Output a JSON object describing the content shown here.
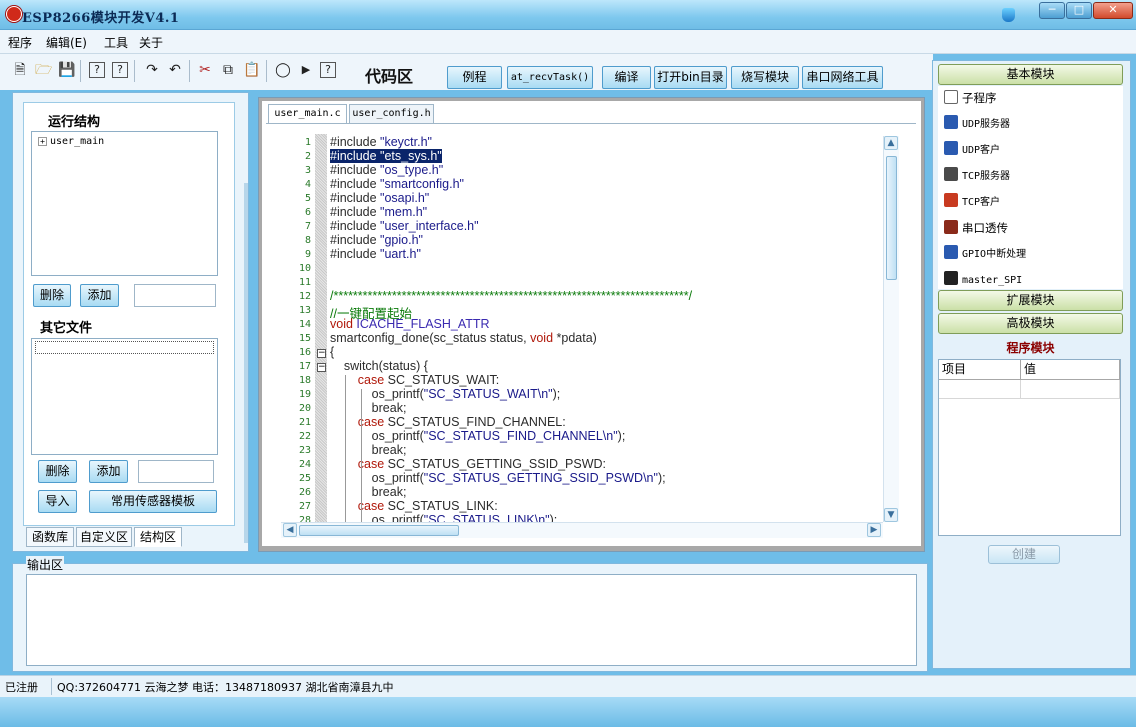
{
  "window": {
    "title": "ESP8266模块开发V4.1"
  },
  "menu": [
    "程序",
    "编辑(E)",
    "工具",
    "关于"
  ],
  "toolbar": {
    "code_area_label": "代码区",
    "buttons": [
      "例程",
      "at_recvTask()",
      "编译",
      "打开bin目录",
      "烧写模块",
      "串口网络工具"
    ]
  },
  "left_panel": {
    "run_structure_title": "运行结构",
    "tree_items": [
      "user_main"
    ],
    "delete_label": "删除",
    "add_label": "添加",
    "other_files_title": "其它文件",
    "import_label": "导入",
    "sensor_template_label": "常用传感器模板",
    "tabs": [
      "函数库",
      "自定义区",
      "结构区"
    ]
  },
  "editor": {
    "tabs": [
      "user_main.c",
      "user_config.h"
    ],
    "lines": [
      "#include \"keyctr.h\"",
      "#include \"ets_sys.h\"",
      "#include \"os_type.h\"",
      "#include \"smartconfig.h\"",
      "#include \"osapi.h\"",
      "#include \"mem.h\"",
      "#include \"user_interface.h\"",
      "#include \"gpio.h\"",
      "#include \"uart.h\"",
      "",
      "",
      "/*************************************************************************/",
      "//一键配置起始",
      "void ICACHE_FLASH_ATTR",
      "smartconfig_done(sc_status status, void *pdata)",
      "{",
      "    switch(status) {",
      "        case SC_STATUS_WAIT:",
      "            os_printf(\"SC_STATUS_WAIT\\n\");",
      "            break;",
      "        case SC_STATUS_FIND_CHANNEL:",
      "            os_printf(\"SC_STATUS_FIND_CHANNEL\\n\");",
      "            break;",
      "        case SC_STATUS_GETTING_SSID_PSWD:",
      "            os_printf(\"SC_STATUS_GETTING_SSID_PSWD\\n\");",
      "            break;",
      "        case SC_STATUS_LINK:",
      "            os_printf(\"SC_STATUS_LINK\\n\");"
    ],
    "highlighted_line": 2
  },
  "output": {
    "label": "输出区"
  },
  "right_panel": {
    "basic_modules": "基本模块",
    "module_items": [
      {
        "label": "子程序",
        "icon": "document-icon",
        "color": "#ffffff"
      },
      {
        "label": "UDP服务器",
        "icon": "network-icon",
        "color": "#2a5ab0"
      },
      {
        "label": "UDP客户",
        "icon": "network-icon",
        "color": "#2a5ab0"
      },
      {
        "label": "TCP服务器",
        "icon": "server-icon",
        "color": "#4a4a4a"
      },
      {
        "label": "TCP客户",
        "icon": "users-icon",
        "color": "#c83a20"
      },
      {
        "label": "串口透传",
        "icon": "plug-icon",
        "color": "#8a2a1a"
      },
      {
        "label": "GPIO中断处理",
        "icon": "gpio-icon",
        "color": "#2a5ab0"
      },
      {
        "label": "master_SPI",
        "icon": "chip-icon",
        "color": "#222222"
      }
    ],
    "extended_modules": "扩展模块",
    "advanced_modules": "高极模块",
    "program_module_title": "程序模块",
    "grid_headers": [
      "项目",
      "值"
    ],
    "create_label": "创建"
  },
  "status": {
    "registered": "已注册",
    "contact": "QQ:372604771 云海之梦 电话：13487180937 湖北省南漳县九中"
  }
}
